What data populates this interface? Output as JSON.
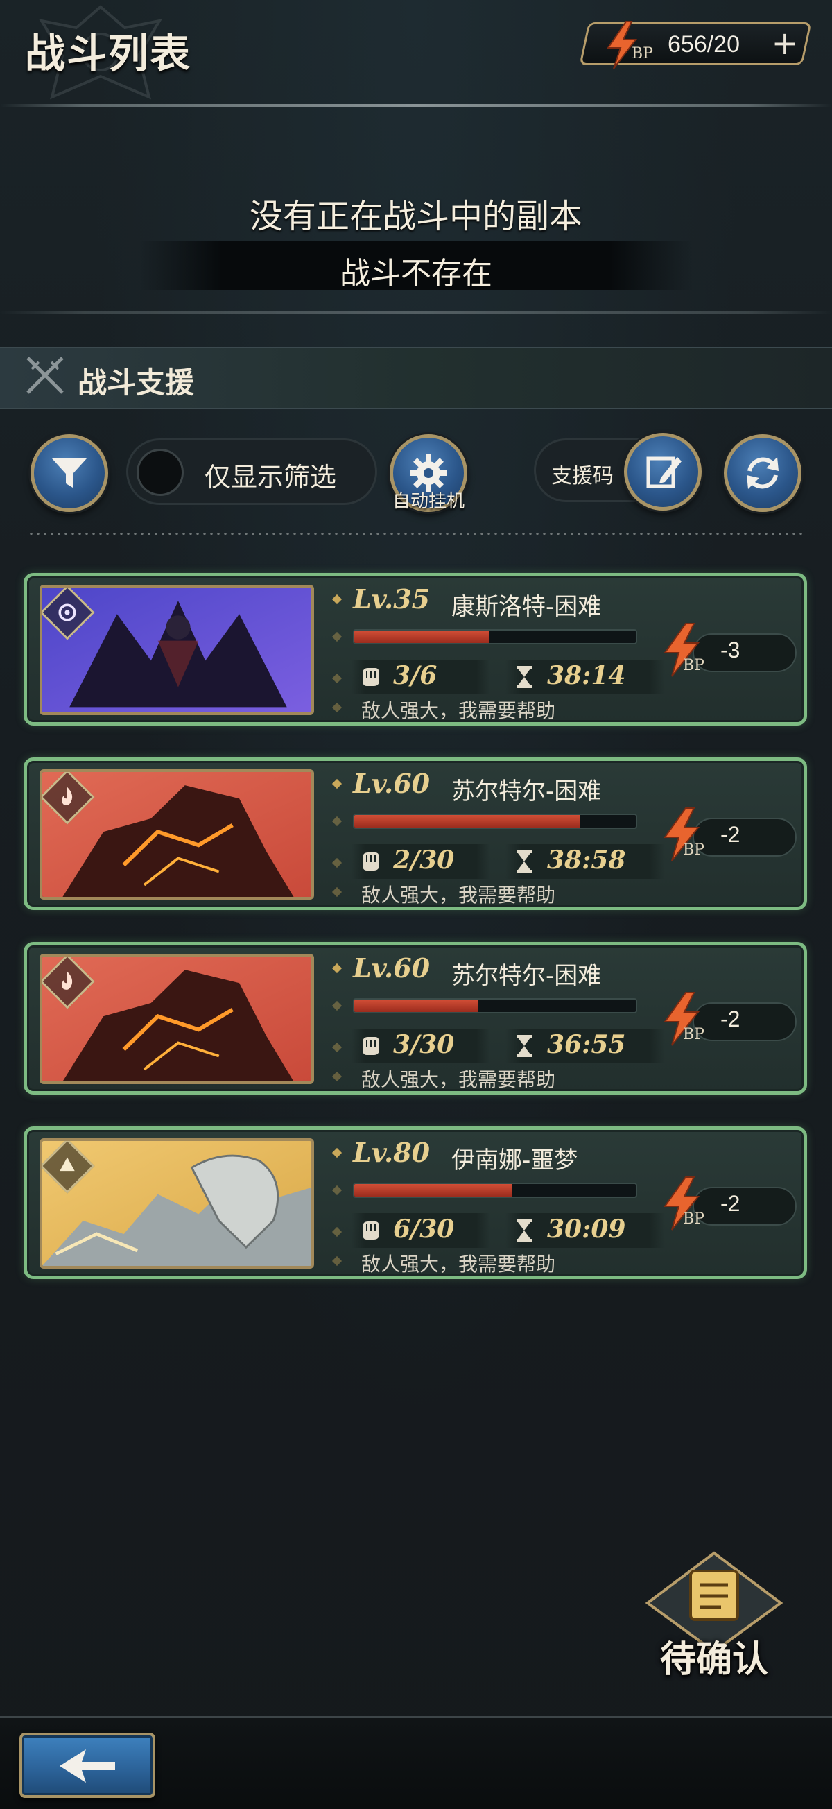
{
  "header": {
    "title": "战斗列表",
    "bp_label": "BP",
    "bp_count": "656/20",
    "plus_label": "+"
  },
  "status": {
    "main": "没有正在战斗中的副本",
    "sub": "战斗不存在"
  },
  "section": {
    "title": "战斗支援"
  },
  "toolbar": {
    "filter_only_label": "仅显示筛选",
    "auto_battle_label": "自动挂机",
    "support_code_label": "支援码"
  },
  "battles": [
    {
      "level": "Lv.35",
      "name": "康斯洛特-困难",
      "hp_fraction": 0.48,
      "participants": "3/6",
      "time_left": "38:14",
      "message": "敌人强大，我需要帮助",
      "bp_cost": "-3",
      "bp_label": "BP",
      "element": "dark"
    },
    {
      "level": "Lv.60",
      "name": "苏尔特尔-困难",
      "hp_fraction": 0.8,
      "participants": "2/30",
      "time_left": "38:58",
      "message": "敌人强大，我需要帮助",
      "bp_cost": "-2",
      "bp_label": "BP",
      "element": "fire"
    },
    {
      "level": "Lv.60",
      "name": "苏尔特尔-困难",
      "hp_fraction": 0.44,
      "participants": "3/30",
      "time_left": "36:55",
      "message": "敌人强大，我需要帮助",
      "bp_cost": "-2",
      "bp_label": "BP",
      "element": "fire"
    },
    {
      "level": "Lv.80",
      "name": "伊南娜-噩梦",
      "hp_fraction": 0.56,
      "participants": "6/30",
      "time_left": "30:09",
      "message": "敌人强大，我需要帮助",
      "bp_cost": "-2",
      "bp_label": "BP",
      "element": "earth"
    }
  ],
  "pending": {
    "label": "待确认"
  },
  "icons": {
    "filter": "funnel-icon",
    "auto": "gear-icon",
    "support_code": "edit-icon",
    "refresh": "refresh-icon",
    "back": "back-arrow-icon",
    "participants": "fist-icon",
    "timer": "hourglass-icon",
    "bp": "lightning-bolt-icon"
  },
  "colors": {
    "card_border": "#7dbb82",
    "accent_gold": "#e7cf8f",
    "hp_bar": "#c4412e",
    "button_blue": "#2b568a"
  }
}
